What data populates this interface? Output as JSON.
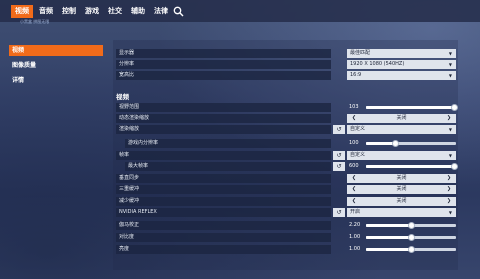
{
  "colors": {
    "accent": "#f16b1a",
    "row_bg": "#1c2642",
    "control_bg": "#dfe4ec"
  },
  "nav": {
    "tabs": [
      {
        "label": "视频",
        "active": true
      },
      {
        "label": "音频",
        "active": false
      },
      {
        "label": "控制",
        "active": false
      },
      {
        "label": "游戏",
        "active": false
      },
      {
        "label": "社交",
        "active": false
      },
      {
        "label": "辅助",
        "active": false
      },
      {
        "label": "法律",
        "active": false
      }
    ],
    "search_icon": "search-icon",
    "watermark": "小黑盒 拼图无限"
  },
  "sidebar": {
    "items": [
      {
        "label": "视频",
        "active": true
      },
      {
        "label": "图像质量",
        "active": false
      },
      {
        "label": "详情",
        "active": false
      }
    ]
  },
  "display": {
    "rows": [
      {
        "label": "显示器",
        "value": "最佳匹配",
        "type": "dropdown"
      },
      {
        "label": "分辨率",
        "value": "1920 X 1080 (540HZ)",
        "type": "dropdown"
      },
      {
        "label": "宽高比",
        "value": "16:9",
        "type": "dropdown"
      }
    ]
  },
  "video": {
    "section_title": "视频",
    "field_of_view": {
      "label": "视野范围",
      "value": "103",
      "fraction": 0.98
    },
    "dynamic_render_scale": {
      "label": "动态渲染缩放",
      "value": "关闭"
    },
    "render_scale": {
      "label": "渲染缩放",
      "value": "自定义"
    },
    "render_scale_custom": {
      "label": "游戏内分辨率",
      "value": "100",
      "fraction": 0.33
    },
    "frame_rate": {
      "label": "帧率",
      "value": "自定义"
    },
    "max_fps": {
      "label": "最大帧率",
      "value": "600",
      "fraction": 0.98
    },
    "vsync": {
      "label": "垂直同步",
      "value": "关闭"
    },
    "triple_buffering": {
      "label": "三重缓冲",
      "value": "关闭"
    },
    "reduce_buffering": {
      "label": "减少缓冲",
      "value": "关闭"
    },
    "nvidia_reflex": {
      "label": "NVIDIA REFLEX",
      "value": "开启"
    },
    "gamma": {
      "label": "伽马校正",
      "value": "2.20",
      "fraction": 0.5
    },
    "contrast": {
      "label": "对比度",
      "value": "1.00",
      "fraction": 0.5
    },
    "brightness": {
      "label": "亮度",
      "value": "1.00",
      "fraction": 0.5
    }
  },
  "icons": {
    "reset": "reset-icon",
    "left": "arrow-left-icon",
    "right": "arrow-right-icon",
    "caret": "caret-down-icon"
  }
}
